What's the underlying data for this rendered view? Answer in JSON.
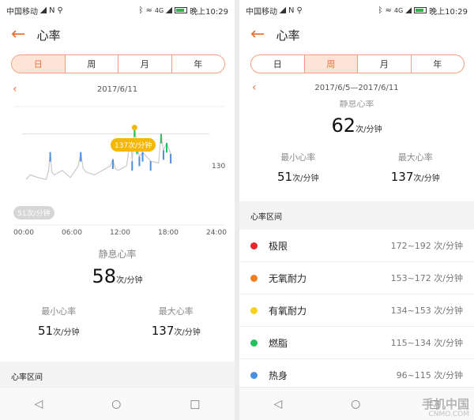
{
  "status_bar": {
    "carrier": "中国移动",
    "nfc": "N",
    "time": "晚上10:29",
    "net": "4G"
  },
  "header": {
    "back_icon": "←",
    "title": "心率"
  },
  "tabs": [
    "日",
    "周",
    "月",
    "年"
  ],
  "left": {
    "active_tab": 0,
    "date": "2017/6/11",
    "max_bubble": "137次/分钟",
    "min_bubble": "51次/分钟",
    "ref_value": "130",
    "rest_label": "静息心率",
    "rest_value": "58",
    "unit": "次/分钟",
    "min_label": "最小心率",
    "min_value": "51",
    "max_label": "最大心率",
    "max_value": "137",
    "zone_header": "心率区间",
    "chart_data": {
      "type": "line",
      "x_ticks": [
        "00:00",
        "06:00",
        "12:00",
        "18:00",
        "24:00"
      ],
      "reference_line": 130,
      "min_point": {
        "time": "03:00",
        "value": 51
      },
      "max_point": {
        "time": "14:00",
        "value": 137
      },
      "series": [
        {
          "x_hours": [
            0.5,
            1,
            2,
            3,
            3.3,
            3.5,
            3.7,
            4,
            5,
            6,
            7,
            7.3,
            7.6,
            8,
            9,
            10,
            11,
            11.3,
            11.6,
            12,
            13,
            13.5,
            13.7,
            14,
            14.3,
            14.6,
            15,
            16,
            17,
            17.3,
            17.6,
            18,
            18.5
          ],
          "values": [
            80,
            85,
            82,
            80,
            90,
            110,
            88,
            85,
            90,
            82,
            95,
            110,
            92,
            88,
            85,
            90,
            95,
            102,
            92,
            90,
            95,
            125,
            100,
            137,
            118,
            105,
            110,
            100,
            98,
            130,
            112,
            120,
            108
          ]
        }
      ]
    }
  },
  "right": {
    "active_tab": 1,
    "date": "2017/6/5—2017/6/11",
    "rest_label_cut": "静息心率",
    "rest_value": "62",
    "unit": "次/分钟",
    "min_label": "最小心率",
    "min_value": "51",
    "max_label": "最大心率",
    "max_value": "137",
    "zone_header": "心率区间",
    "zones": [
      {
        "name": "极限",
        "range": "172~192 次/分钟",
        "color": "#e8262b"
      },
      {
        "name": "无氧耐力",
        "range": "153~172 次/分钟",
        "color": "#f07e1e"
      },
      {
        "name": "有氧耐力",
        "range": "134~153 次/分钟",
        "color": "#f5d222"
      },
      {
        "name": "燃脂",
        "range": "115~134 次/分钟",
        "color": "#22c25c"
      },
      {
        "name": "热身",
        "range": "96~115 次/分钟",
        "color": "#4a90e2"
      }
    ]
  },
  "nav": {
    "back": "◁",
    "home": "○",
    "recent": "□"
  },
  "watermark": {
    "line1": "手机中国",
    "line2": "CNMO.COM"
  }
}
